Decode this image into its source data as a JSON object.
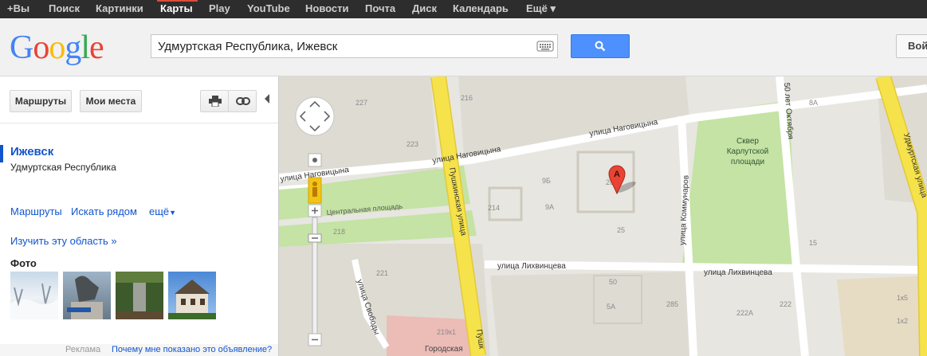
{
  "topbar": {
    "items": [
      {
        "label": "+Вы",
        "active": false
      },
      {
        "label": "Поиск",
        "active": false
      },
      {
        "label": "Картинки",
        "active": false
      },
      {
        "label": "Карты",
        "active": true
      },
      {
        "label": "Play",
        "active": false
      },
      {
        "label": "YouTube",
        "active": false
      },
      {
        "label": "Новости",
        "active": false
      },
      {
        "label": "Почта",
        "active": false
      },
      {
        "label": "Диск",
        "active": false
      },
      {
        "label": "Календарь",
        "active": false
      },
      {
        "label": "Ещё ▾",
        "active": false
      }
    ]
  },
  "header": {
    "logo_text": "Google",
    "search_value": "Удмуртская Республика, Ижевск",
    "login_label": "Вой"
  },
  "panel": {
    "routes_button": "Маршруты",
    "my_places_button": "Мои места",
    "place_title": "Ижевск",
    "place_subtitle": "Удмуртская Республика",
    "actions": {
      "routes": "Маршруты",
      "nearby": "Искать рядом",
      "more": "ещё"
    },
    "explore_link": "Изучить эту область »",
    "photos_label": "Фото",
    "ad_label": "Реклама",
    "ad_why": "Почему мне показано это объявление?"
  },
  "map": {
    "streets": {
      "nagovitsyna_west": "улица Наговицына",
      "nagovitsyna_mid": "улица Наговицына",
      "nagovitsyna_east": "улица Наговицына",
      "pushkinskaya": "Пушкинская улица",
      "pushkinskaya_bottom": "Пушк",
      "likhvintseva_mid": "улица Лихвинцева",
      "likhvintseva_east": "улица Лихвинцева",
      "kommunarov": "улица Коммунаров",
      "oktyabrya": "50 лет Октября",
      "udmurtskaya": "Удмуртская улица",
      "svobody": "улица Свободы",
      "central_square": "Центральная площадь",
      "gorodskaya": "Городская"
    },
    "park_label": "Сквер Карлутской площади",
    "marker_label": "A",
    "building_numbers": [
      "227",
      "223",
      "216",
      "218",
      "221",
      "219к1",
      "214",
      "9Б",
      "9А",
      "28",
      "25",
      "50",
      "5А",
      "285",
      "222А",
      "222",
      "8А",
      "15",
      "1к5",
      "1к2"
    ],
    "colors": {
      "road_major": "#f6e24a",
      "park": "#c4e3a4",
      "background": "#e7e6e1"
    }
  }
}
